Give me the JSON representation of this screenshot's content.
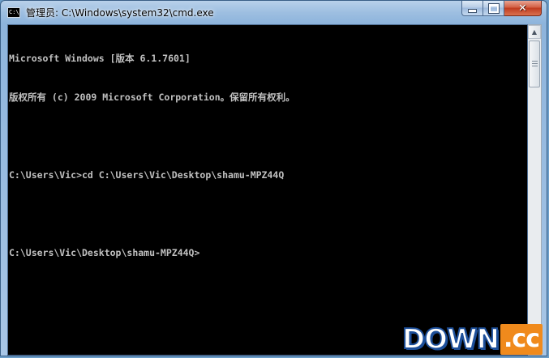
{
  "window": {
    "title": "管理员: C:\\Windows\\system32\\cmd.exe",
    "icon_label": "C:\\"
  },
  "caption_buttons": {
    "minimize": "minimize-icon",
    "maximize": "maximize-icon",
    "close": "✕"
  },
  "console": {
    "lines": [
      "Microsoft Windows [版本 6.1.7601]",
      "版权所有 (c) 2009 Microsoft Corporation。保留所有权利。",
      "",
      "C:\\Users\\Vic>cd C:\\Users\\Vic\\Desktop\\shamu-MPZ44Q",
      "",
      "C:\\Users\\Vic\\Desktop\\shamu-MPZ44Q>"
    ],
    "text_color": "#c0c0c0",
    "background": "#000000"
  },
  "scrollbar": {
    "up_glyph": "▲",
    "down_glyph": "▼"
  },
  "watermark": {
    "main": "DOWN",
    "suffix": ".cc"
  },
  "colors": {
    "frame": "#9ebfe1",
    "close_button": "#c7432a",
    "watermark_orange": "#f08a1c",
    "watermark_blue": "#1d4f9a"
  }
}
